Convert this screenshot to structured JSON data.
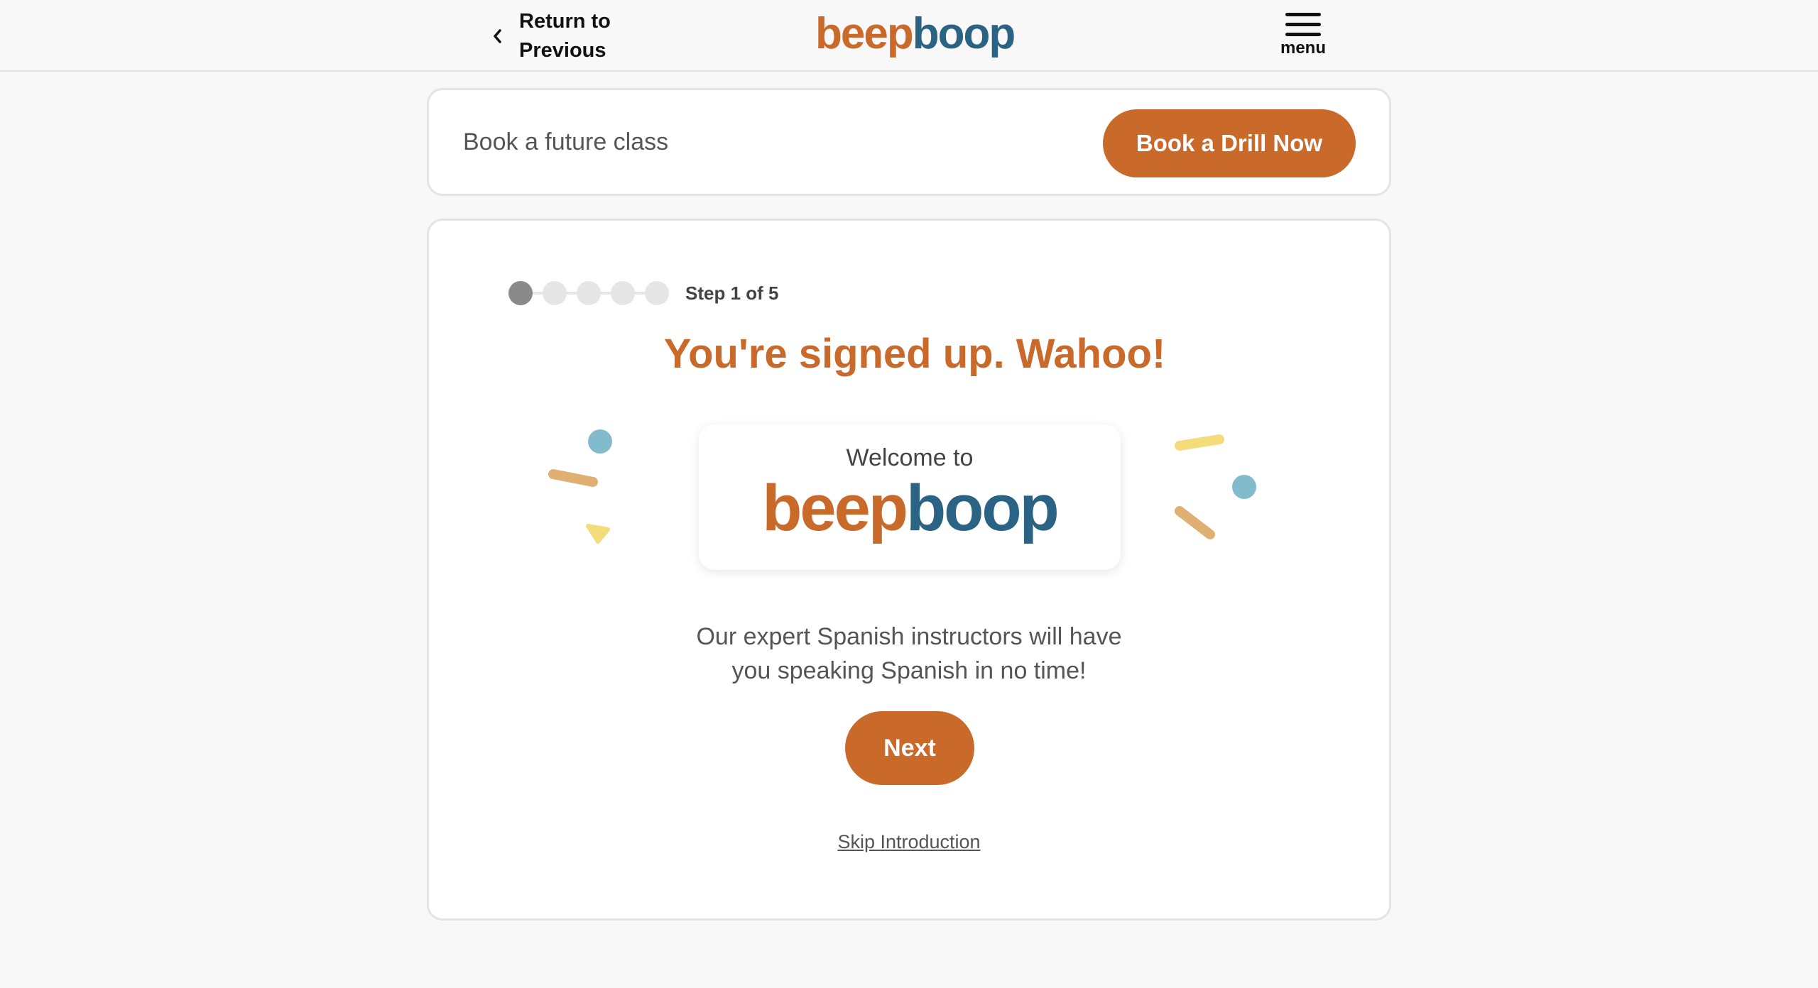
{
  "header": {
    "back_label_line1": "Return to",
    "back_label_line2": "Previous",
    "brand_part1": "beep",
    "brand_part2": "boop",
    "menu_label": "menu"
  },
  "book_card": {
    "text": "Book a future class",
    "button_label": "Book a Drill Now"
  },
  "onboarding": {
    "step_text": "Step 1 of 5",
    "current_step": 1,
    "total_steps": 5,
    "headline": "You're signed up. Wahoo!",
    "welcome_text": "Welcome to",
    "logo_part1": "beep",
    "logo_part2": "boop",
    "description_line1": "Our expert Spanish instructors will have",
    "description_line2": "you speaking Spanish in no time!",
    "next_label": "Next",
    "skip_label": "Skip Introduction"
  },
  "colors": {
    "accent_orange": "#c96a2b",
    "brand_blue": "#2a6384",
    "confetti_blue": "#82bccc",
    "confetti_tan": "#dfb072",
    "confetti_yellow": "#f5dc7a"
  }
}
